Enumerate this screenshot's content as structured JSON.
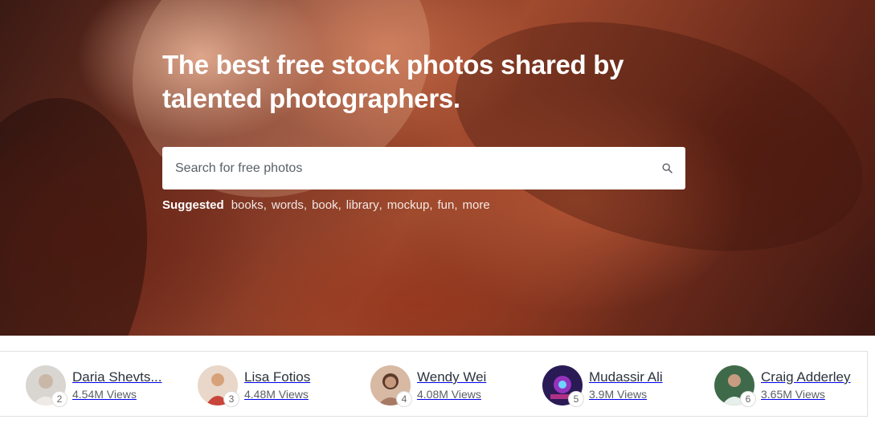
{
  "hero": {
    "title": "The best free stock photos shared by talented photographers."
  },
  "search": {
    "placeholder": "Search for free photos",
    "icon": "search-icon"
  },
  "suggested": {
    "label": "Suggested",
    "tags": [
      "books",
      "words",
      "book",
      "library",
      "mockup",
      "fun"
    ],
    "more": "more"
  },
  "leaders": [
    {
      "name": "Daria Shevts...",
      "views": "4.54M Views",
      "rank": "2",
      "avatar_color": "#d9d6d2"
    },
    {
      "name": "Lisa Fotios",
      "views": "4.48M Views",
      "rank": "3",
      "avatar_color": "#e9d7c9"
    },
    {
      "name": "Wendy Wei",
      "views": "4.08M Views",
      "rank": "4",
      "avatar_color": "#d7b9a4"
    },
    {
      "name": "Mudassir Ali",
      "views": "3.9M Views",
      "rank": "5",
      "avatar_color": "#2a1a55"
    },
    {
      "name": "Craig Adderley",
      "views": "3.65M Views",
      "rank": "6",
      "avatar_color": "#3f6a4a"
    }
  ]
}
